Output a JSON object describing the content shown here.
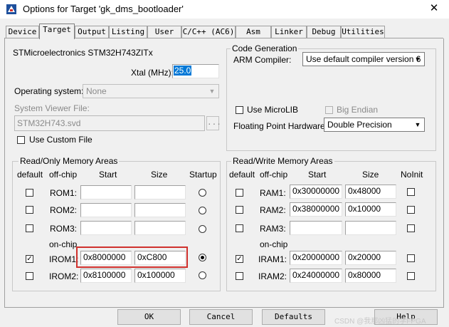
{
  "window": {
    "title": "Options for Target 'gk_dms_bootloader'",
    "close_glyph": "✕"
  },
  "tabs": [
    "Device",
    "Target",
    "Output",
    "Listing",
    "User",
    "C/C++ (AC6)",
    "Asm",
    "Linker",
    "Debug",
    "Utilities"
  ],
  "active_tab": "Target",
  "device": {
    "name": "STMicroelectronics STM32H743ZITx",
    "xtal_label": "Xtal (MHz):",
    "xtal_value": "25.0",
    "os_label": "Operating system:",
    "os_value": "None",
    "svd_label": "System Viewer File:",
    "svd_value": "STM32H743.svd",
    "browse_label": "...",
    "custom_file_label": "Use Custom File"
  },
  "code_gen": {
    "title": "Code Generation",
    "compiler_label": "ARM Compiler:",
    "compiler_value": "Use default compiler version 6",
    "microlib_label": "Use MicroLIB",
    "big_endian_label": "Big Endian",
    "fpu_label": "Floating Point Hardware:",
    "fpu_value": "Double Precision"
  },
  "ro_memory": {
    "title": "Read/Only Memory Areas",
    "headers": {
      "default": "default",
      "offchip": "off-chip",
      "start": "Start",
      "size": "Size",
      "startup": "Startup"
    },
    "onchip_label": "on-chip",
    "rows": [
      {
        "name": "ROM1:",
        "start": "",
        "size": "",
        "default": false,
        "startup": false
      },
      {
        "name": "ROM2:",
        "start": "",
        "size": "",
        "default": false,
        "startup": false
      },
      {
        "name": "ROM3:",
        "start": "",
        "size": "",
        "default": false,
        "startup": false
      },
      {
        "name": "IROM1:",
        "start": "0x8000000",
        "size": "0xC800",
        "default": true,
        "startup": true
      },
      {
        "name": "IROM2:",
        "start": "0x8100000",
        "size": "0x100000",
        "default": false,
        "startup": false
      }
    ]
  },
  "rw_memory": {
    "title": "Read/Write Memory Areas",
    "headers": {
      "default": "default",
      "offchip": "off-chip",
      "start": "Start",
      "size": "Size",
      "noinit": "NoInit"
    },
    "onchip_label": "on-chip",
    "rows": [
      {
        "name": "RAM1:",
        "start": "0x30000000",
        "size": "0x48000",
        "default": false,
        "noinit": false
      },
      {
        "name": "RAM2:",
        "start": "0x38000000",
        "size": "0x10000",
        "default": false,
        "noinit": false
      },
      {
        "name": "RAM3:",
        "start": "",
        "size": "",
        "default": false,
        "noinit": false
      },
      {
        "name": "IRAM1:",
        "start": "0x20000000",
        "size": "0x20000",
        "default": true,
        "noinit": false
      },
      {
        "name": "IRAM2:",
        "start": "0x24000000",
        "size": "0x80000",
        "default": false,
        "noinit": false
      }
    ]
  },
  "buttons": {
    "ok": "OK",
    "cancel": "Cancel",
    "defaults": "Defaults",
    "help": "Help"
  },
  "watermark": "CSDN @我那凶猛的学FPGA",
  "checkmark": "✓"
}
